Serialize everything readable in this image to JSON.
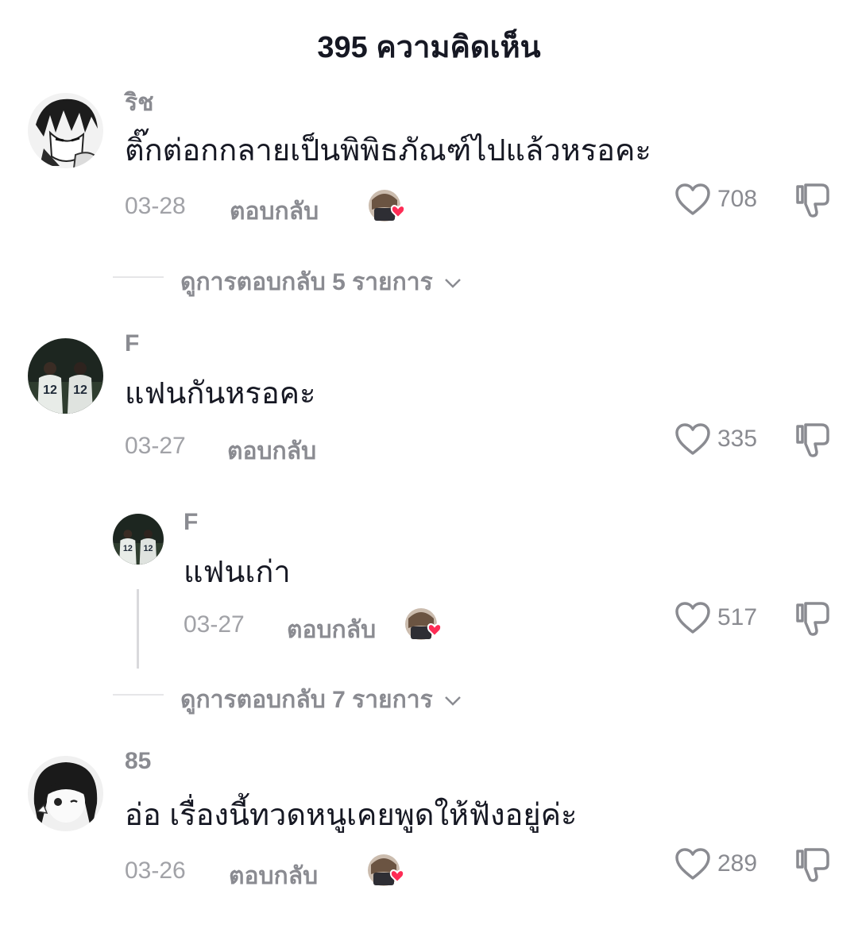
{
  "header": {
    "title": "395 ความคิดเห็น"
  },
  "comments": [
    {
      "username": "ริช",
      "text": "ติ๊กต่อกกลายเป็นพิพิธภัณฑ์ไปแล้วหรอคะ",
      "date": "03-28",
      "reply_label": "ตอบกลับ",
      "likes": "708",
      "creator_liked": true,
      "view_replies": "ดูการตอบกลับ 5 รายการ"
    },
    {
      "username": "F",
      "text": "แฟนกันหรอคะ",
      "date": "03-27",
      "reply_label": "ตอบกลับ",
      "likes": "335",
      "creator_liked": false
    },
    {
      "username": "F",
      "text": "แฟนเก่า",
      "date": "03-27",
      "reply_label": "ตอบกลับ",
      "likes": "517",
      "creator_liked": true,
      "view_replies": "ดูการตอบกลับ 7 รายการ"
    },
    {
      "username": "85",
      "text": "อ่อ เรื่องนี้ทวดหนูเคยพูดให้ฟังอยู่ค่ะ",
      "date": "03-26",
      "reply_label": "ตอบกลับ",
      "likes": "289",
      "creator_liked": true
    }
  ],
  "icons": {
    "like": "heart-outline-icon",
    "dislike": "thumbs-down-icon",
    "chevron": "chevron-down-icon"
  },
  "colors": {
    "text": "#161823",
    "muted": "#8a8b91",
    "creator_heart": "#fe2c55"
  }
}
